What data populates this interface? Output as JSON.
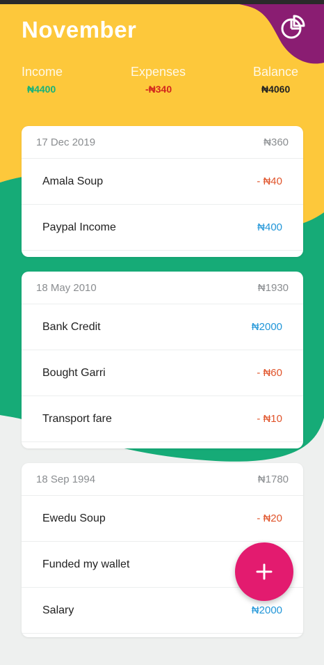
{
  "colors": {
    "header_yellow": "#fdc83b",
    "accent_green": "#16ab77",
    "corner_purple": "#8a1d72",
    "fab_pink": "#e31b6f",
    "income_green": "#16b27a",
    "expense_red": "#d2261d",
    "expense_amount": "#e0542b",
    "income_amount": "#2196d8"
  },
  "header": {
    "title": "November",
    "chart_icon": "pie-chart-icon",
    "stats": {
      "income_label": "Income",
      "income_value": "₦4400",
      "expenses_label": "Expenses",
      "expenses_value": "-₦340",
      "balance_label": "Balance",
      "balance_value": "₦4060"
    }
  },
  "groups": [
    {
      "date": "17 Dec 2019",
      "total": "₦360",
      "items": [
        {
          "name": "Amala Soup",
          "amount": "- ₦40",
          "kind": "expense"
        },
        {
          "name": "Paypal Income",
          "amount": "₦400",
          "kind": "income"
        }
      ]
    },
    {
      "date": "18 May 2010",
      "total": "₦1930",
      "items": [
        {
          "name": "Bank Credit",
          "amount": "₦2000",
          "kind": "income"
        },
        {
          "name": "Bought Garri",
          "amount": "- ₦60",
          "kind": "expense"
        },
        {
          "name": "Transport fare",
          "amount": "- ₦10",
          "kind": "expense"
        }
      ]
    },
    {
      "date": "18 Sep 1994",
      "total": "₦1780",
      "items": [
        {
          "name": "Ewedu Soup",
          "amount": "- ₦20",
          "kind": "expense"
        },
        {
          "name": "Funded my wallet",
          "amount": "",
          "kind": "income"
        },
        {
          "name": "Salary",
          "amount": "₦2000",
          "kind": "income"
        }
      ]
    }
  ],
  "fab": {
    "icon": "plus-icon"
  }
}
